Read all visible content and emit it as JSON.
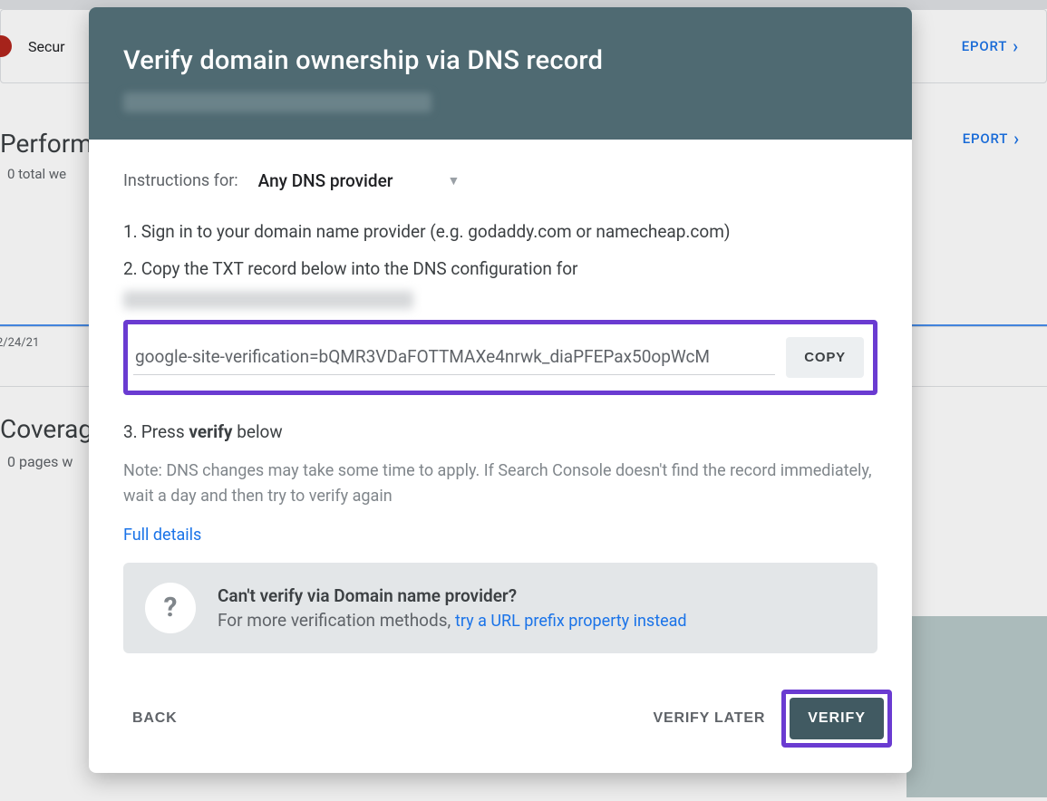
{
  "background": {
    "card_title": "Secur",
    "report_label": "EPORT",
    "perf_heading": "Perform",
    "totals": "0 total we",
    "date": "2/24/21",
    "coverage_heading": "Coverag",
    "pages": "0 pages w"
  },
  "modal": {
    "title": "Verify domain ownership via DNS record",
    "instructions_label": "Instructions for:",
    "provider_selected": "Any DNS provider",
    "steps": {
      "s1": "Sign in to your domain name provider (e.g. godaddy.com or namecheap.com)",
      "s2": "Copy the TXT record below into the DNS configuration for",
      "s3_pre": "Press ",
      "s3_bold": "verify",
      "s3_post": " below"
    },
    "txt_record": "google-site-verification=bQMR3VDaFOTTMAXe4nrwk_diaPFEPax50opWcM",
    "copy_label": "COPY",
    "note": "Note: DNS changes may take some time to apply. If Search Console doesn't find the record immediately, wait a day and then try to verify again",
    "full_details": "Full details",
    "alt_title": "Can't verify via Domain name provider?",
    "alt_sub_pre": "For more verification methods, ",
    "alt_link": "try a URL prefix property instead",
    "back": "BACK",
    "verify_later": "VERIFY LATER",
    "verify": "VERIFY"
  }
}
